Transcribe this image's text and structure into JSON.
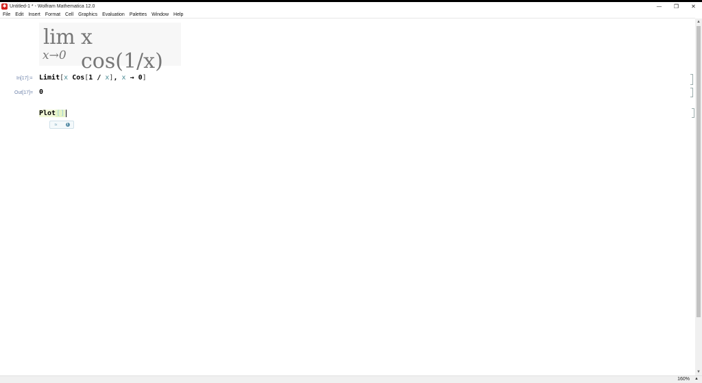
{
  "window": {
    "title": "Untitled-1 * - Wolfram Mathematica 12.0",
    "controls": {
      "minimize": "—",
      "restore": "❐",
      "close": "✕"
    }
  },
  "menu": [
    "File",
    "Edit",
    "Insert",
    "Format",
    "Cell",
    "Graphics",
    "Evaluation",
    "Palettes",
    "Window",
    "Help"
  ],
  "notebook": {
    "math_cell": {
      "lim": "lim",
      "subscript": "x→0",
      "expression": "x cos(1/x)"
    },
    "input_label": "In[17]:=",
    "input_tokens": {
      "head": "Limit",
      "open": "[",
      "x1": "x",
      "cos": "Cos",
      "arg_open": "[",
      "one_over": "1 / ",
      "x2": "x",
      "arg_close": "]",
      "comma": ", ",
      "x3": "x",
      "arrow": " → 0",
      "close": "]"
    },
    "output_label": "Out[17]=",
    "output_value": "0",
    "current_input": {
      "text": "Plot",
      "bracket": "[]"
    },
    "suggestions": {
      "approx_icon": "≈",
      "info_icon": "i"
    }
  },
  "status": {
    "zoom": "160%",
    "zoom_arrow": "▲"
  },
  "icons": {
    "app": "mathematica-icon",
    "cursor": "mouse-pointer-icon"
  }
}
